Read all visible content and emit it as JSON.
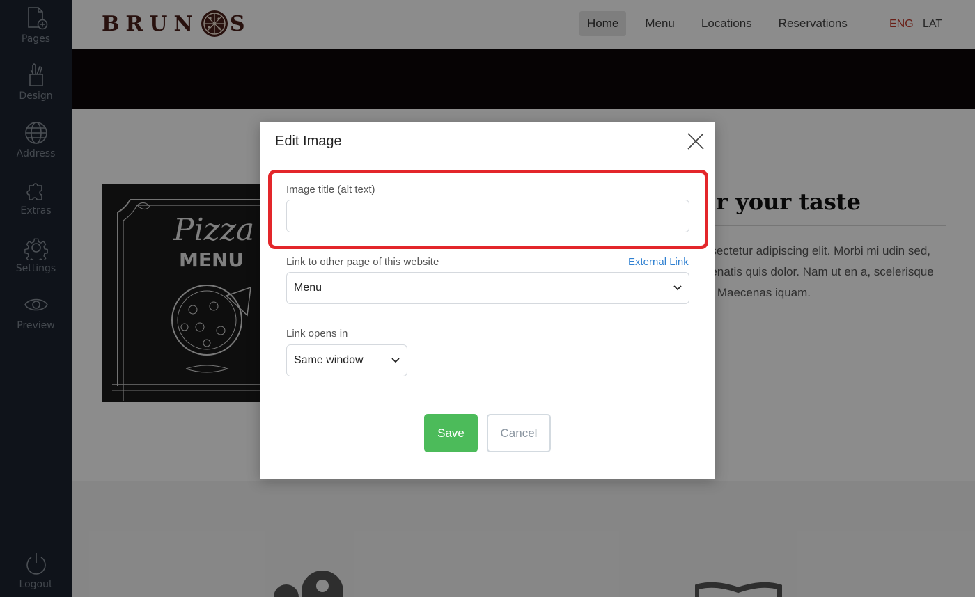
{
  "sidebar": {
    "items": [
      {
        "label": "Pages",
        "icon": "page-add-icon"
      },
      {
        "label": "Design",
        "icon": "pencil-cup-icon"
      },
      {
        "label": "Address",
        "icon": "globe-icon"
      },
      {
        "label": "Extras",
        "icon": "puzzle-icon"
      },
      {
        "label": "Settings",
        "icon": "gear-icon"
      },
      {
        "label": "Preview",
        "icon": "eye-icon"
      }
    ],
    "logout_label": "Logout"
  },
  "site": {
    "logo_text_left": "BRUN",
    "logo_text_right": "S",
    "nav": [
      {
        "label": "Home",
        "active": true
      },
      {
        "label": "Menu",
        "active": false
      },
      {
        "label": "Locations",
        "active": false
      },
      {
        "label": "Reservations",
        "active": false
      }
    ],
    "lang_eng": "ENG",
    "lang_lat": "LAT",
    "menu_image": {
      "line1": "Pizza",
      "line2": "MENU"
    },
    "heading": "for your taste",
    "paragraph": "consectetur adipiscing elit. Morbi mi udin sed, venenatis quis dolor. Nam ut en a, scelerisque orci. Maecenas iquam."
  },
  "modal": {
    "title": "Edit Image",
    "alt_label": "Image title (alt text)",
    "alt_value": "",
    "link_label": "Link to other page of this website",
    "external_link": "External Link",
    "link_value": "Menu",
    "opens_label": "Link opens in",
    "opens_value": "Same window",
    "save_label": "Save",
    "cancel_label": "Cancel"
  },
  "colors": {
    "sidebar": "#1c2430",
    "accent_red": "#e3262a",
    "save_green": "#4cbb5a",
    "link_blue": "#2f80d1"
  }
}
